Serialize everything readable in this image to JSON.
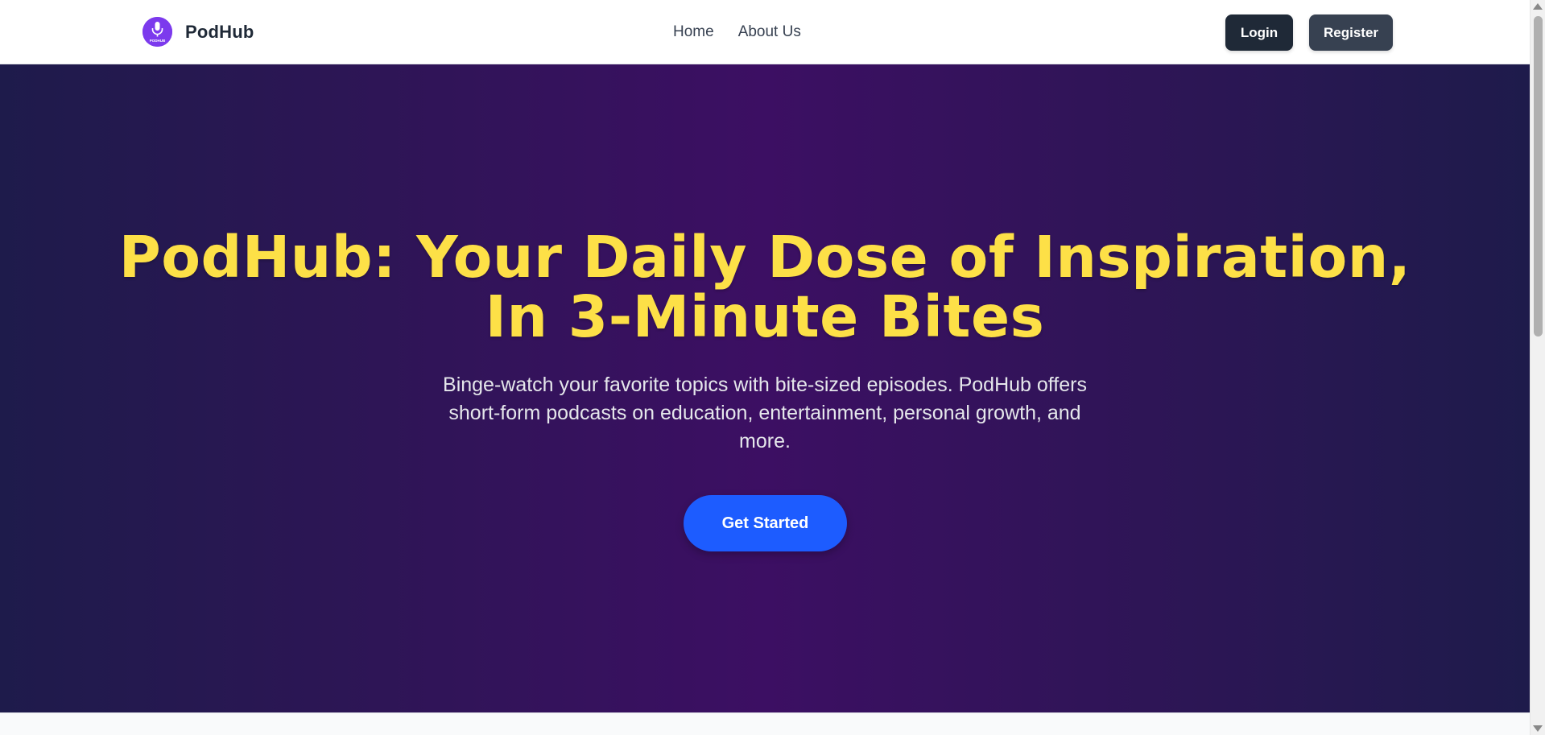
{
  "header": {
    "brand_name": "PodHub",
    "logo_text": "PODHUB",
    "nav": [
      {
        "label": "Home"
      },
      {
        "label": "About Us"
      }
    ],
    "login_label": "Login",
    "register_label": "Register"
  },
  "hero": {
    "title_line1": "PodHub: Your Daily Dose of Inspiration,",
    "title_line2": "In 3-Minute Bites",
    "subtitle": "Binge-watch your favorite topics with bite-sized episodes. PodHub offers short-form podcasts on education, entertainment, personal growth, and more.",
    "cta_label": "Get Started"
  },
  "colors": {
    "title": "#fde047",
    "cta": "#1d5cff",
    "logo": "#7c3aed",
    "login_btn": "#1f2937",
    "register_btn": "#374151",
    "hero_gradient_edge": "#1e1b4b",
    "hero_gradient_center": "#3c0f63"
  },
  "icons": {
    "logo": "microphone-icon"
  }
}
